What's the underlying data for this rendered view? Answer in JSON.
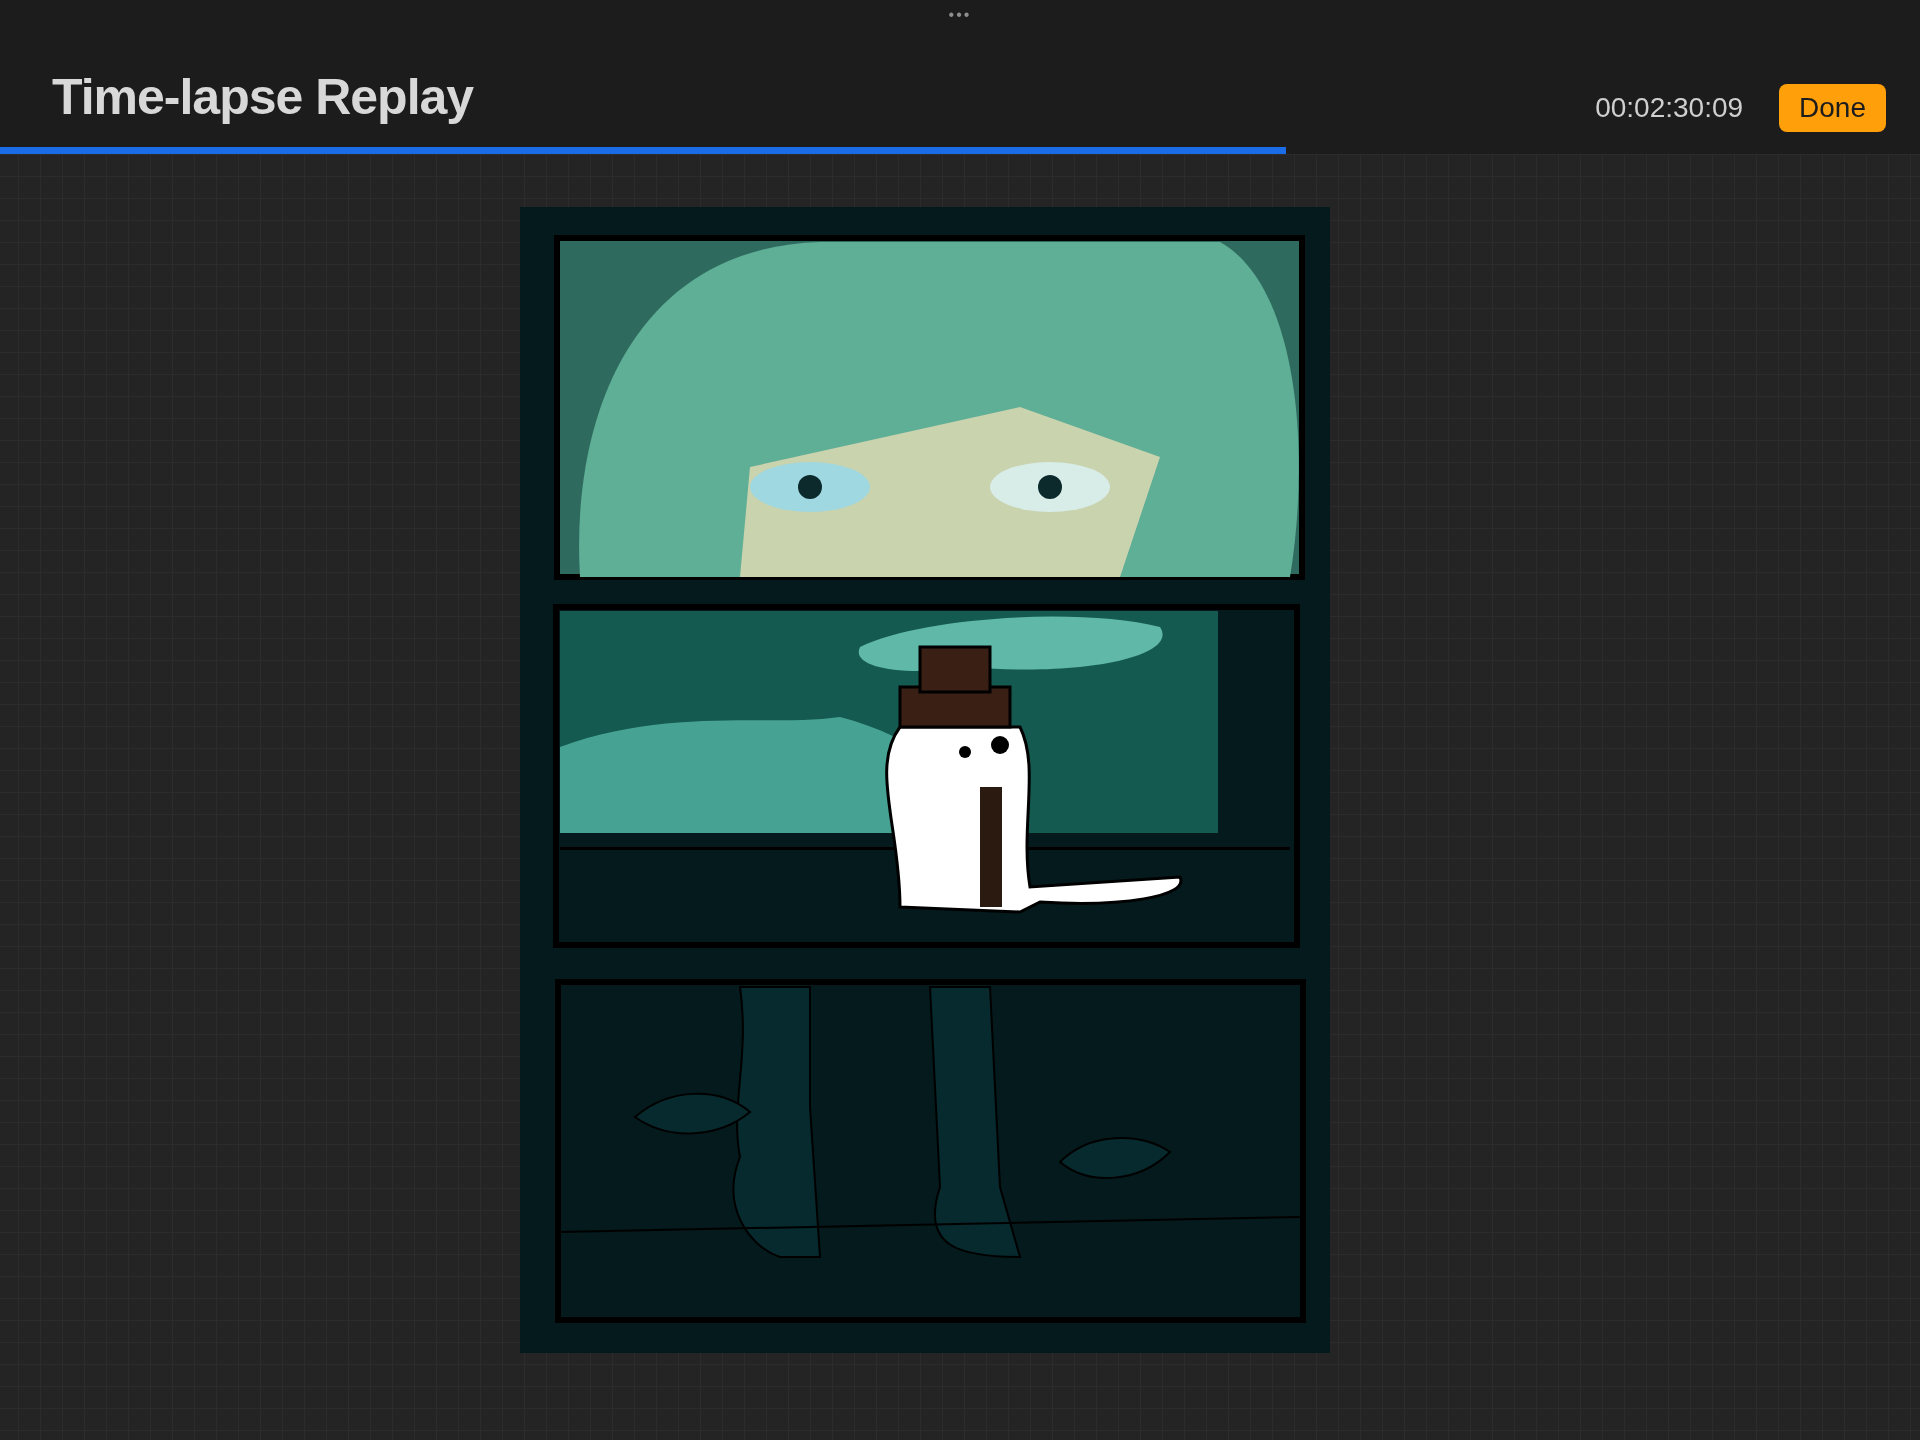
{
  "header": {
    "menu_dots": "•••",
    "title": "Time-lapse Replay",
    "time": "00:02:30:09",
    "done_button": "Done"
  },
  "progress": {
    "level": 0.67
  }
}
